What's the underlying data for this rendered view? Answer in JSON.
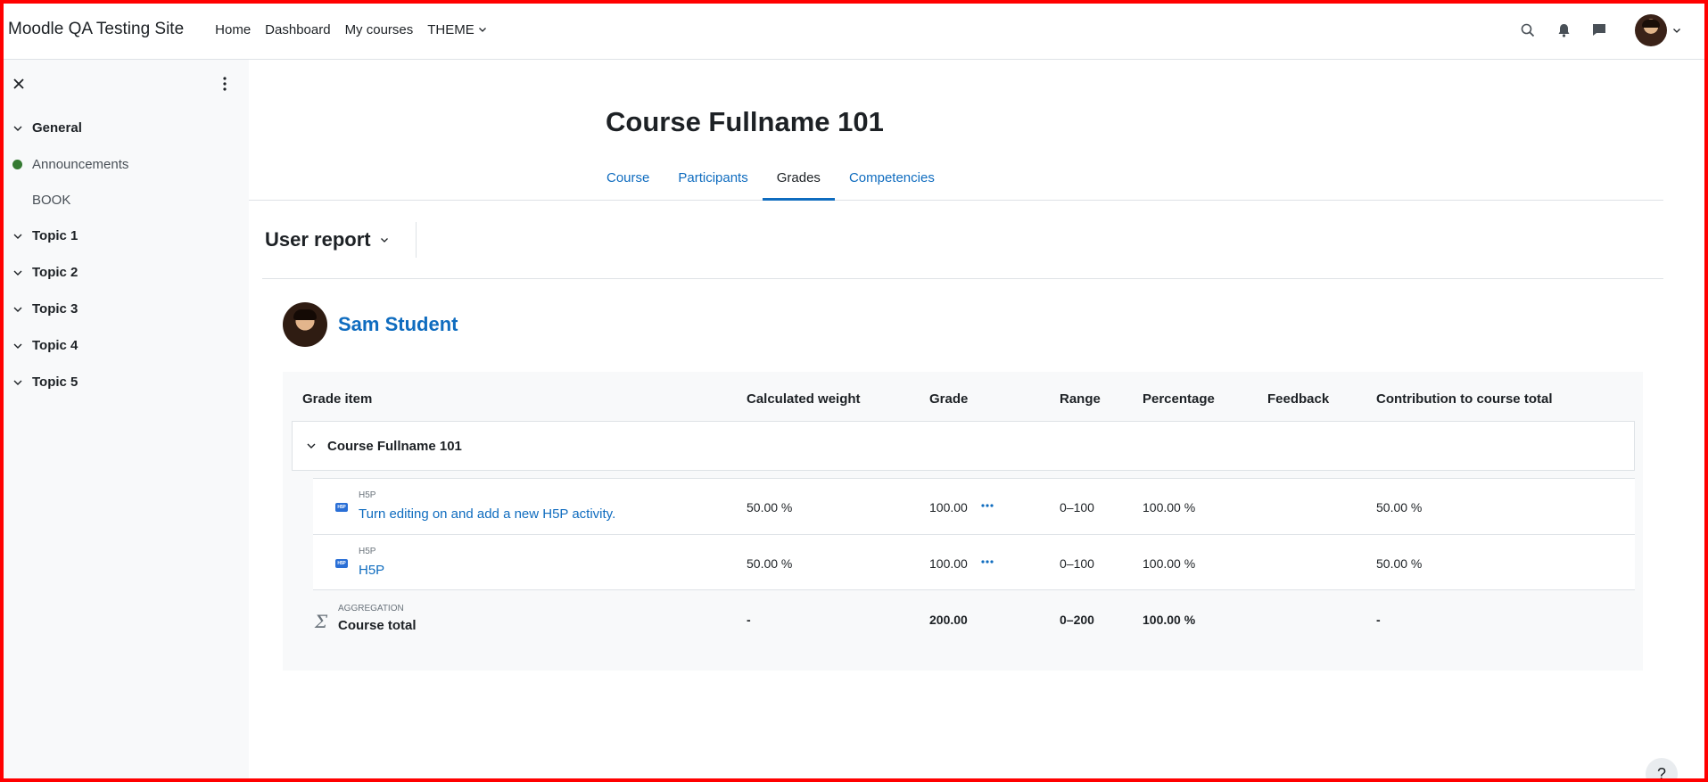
{
  "navbar": {
    "site_name": "Moodle QA Testing Site",
    "links": [
      {
        "label": "Home"
      },
      {
        "label": "Dashboard"
      },
      {
        "label": "My courses"
      },
      {
        "label": "THEME"
      }
    ]
  },
  "drawer": {
    "items": [
      {
        "kind": "section",
        "label": "General"
      },
      {
        "kind": "activity",
        "label": "Announcements",
        "completed": true
      },
      {
        "kind": "activity",
        "label": "BOOK",
        "completed": false
      },
      {
        "kind": "section",
        "label": "Topic 1"
      },
      {
        "kind": "section",
        "label": "Topic 2"
      },
      {
        "kind": "section",
        "label": "Topic 3"
      },
      {
        "kind": "section",
        "label": "Topic 4"
      },
      {
        "kind": "section",
        "label": "Topic 5"
      }
    ],
    "completion_color": "#357a32"
  },
  "page": {
    "title": "Course Fullname 101",
    "tabs": [
      {
        "label": "Course",
        "active": false
      },
      {
        "label": "Participants",
        "active": false
      },
      {
        "label": "Grades",
        "active": true
      },
      {
        "label": "Competencies",
        "active": false
      }
    ],
    "report_selector": "User report",
    "user_name": "Sam Student"
  },
  "grade_table": {
    "headers": {
      "item": "Grade item",
      "weight": "Calculated weight",
      "grade": "Grade",
      "range": "Range",
      "percentage": "Percentage",
      "feedback": "Feedback",
      "contribution": "Contribution to course total"
    },
    "category": "Course Fullname 101",
    "items": [
      {
        "type": "H5P",
        "name": "Turn editing on and add a new H5P activity.",
        "weight": "50.00 %",
        "grade": "100.00",
        "range": "0–100",
        "percentage": "100.00 %",
        "feedback": "",
        "contribution": "50.00 %"
      },
      {
        "type": "H5P",
        "name": "H5P",
        "weight": "50.00 %",
        "grade": "100.00",
        "range": "0–100",
        "percentage": "100.00 %",
        "feedback": "",
        "contribution": "50.00 %"
      }
    ],
    "total": {
      "type": "AGGREGATION",
      "name": "Course total",
      "weight": "-",
      "grade": "200.00",
      "range": "0–200",
      "percentage": "100.00 %",
      "feedback": "",
      "contribution": "-"
    }
  },
  "help": {
    "label": "?"
  },
  "colors": {
    "link": "#0f6cbf",
    "text": "#1d2125",
    "drawer_bg": "#f8f9fa"
  }
}
